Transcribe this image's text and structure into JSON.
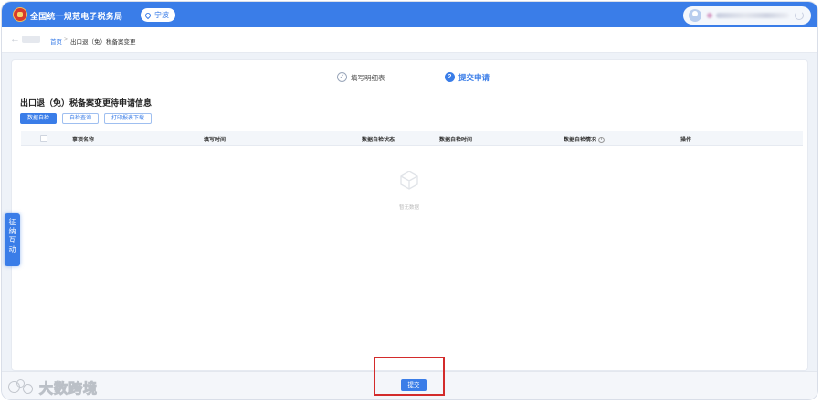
{
  "header": {
    "title": "全国统一规范电子税务局",
    "city": "宁波"
  },
  "breadcrumb": {
    "home": "首页",
    "separator": ">",
    "current": "出口退（免）税备案变更"
  },
  "steps": [
    {
      "index": "✓",
      "label": "填写明细表"
    },
    {
      "index": "2",
      "label": "提交申请"
    }
  ],
  "section": {
    "title": "出口退（免）税备案变更待申请信息"
  },
  "toolbar": {
    "buttons": [
      "数据自检",
      "自检查询",
      "打印报表下载"
    ]
  },
  "table": {
    "columns": [
      "事项名称",
      "填写时间",
      "数据自检状态",
      "数据自检时间",
      "数据自检情况",
      "操作"
    ],
    "info_icon": "i",
    "empty_text": "暂无数据"
  },
  "side_tab": {
    "chars": [
      "征",
      "纳",
      "互",
      "动"
    ]
  },
  "footer": {
    "submit_label": "提交"
  },
  "watermark": {
    "text": "大数跨境"
  },
  "colors": {
    "primary": "#3a7de8",
    "highlight": "#d32b2b"
  }
}
